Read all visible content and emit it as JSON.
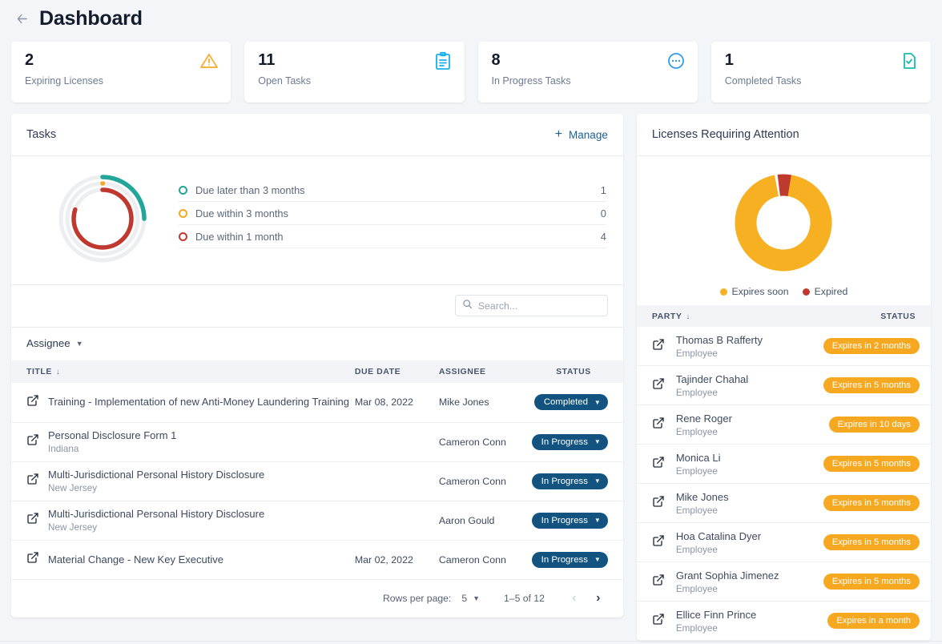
{
  "header": {
    "title": "Dashboard",
    "back_icon": "arrow-left-icon"
  },
  "stats": [
    {
      "value": "2",
      "label": "Expiring Licenses",
      "icon": "warning-triangle-icon",
      "color": "#f6b33d"
    },
    {
      "value": "11",
      "label": "Open Tasks",
      "icon": "clipboard-icon",
      "color": "#17b0f0"
    },
    {
      "value": "8",
      "label": "In Progress Tasks",
      "icon": "in-progress-circle-icon",
      "color": "#2f9ced"
    },
    {
      "value": "1",
      "label": "Completed Tasks",
      "icon": "document-check-icon",
      "color": "#17bcb0"
    }
  ],
  "tasks": {
    "title": "Tasks",
    "manage_label": "Manage",
    "plus_icon": "plus-icon",
    "search": {
      "placeholder": "Search...",
      "value": "",
      "icon": "search-icon"
    },
    "filter": {
      "label": "Assignee",
      "icon": "chevron-down-icon"
    },
    "columns": {
      "title": "TITLE",
      "due_date": "DUE DATE",
      "assignee": "ASSIGNEE",
      "status": "STATUS"
    },
    "rows": [
      {
        "icon": "open-external-icon",
        "title": "Training - Implementation of new Anti-Money Laundering Training",
        "subtitle": "",
        "due": "Mar 08, 2022",
        "assignee": "Mike Jones",
        "status": "Completed"
      },
      {
        "icon": "open-external-icon",
        "title": "Personal Disclosure Form 1",
        "subtitle": "Indiana",
        "due": "",
        "assignee": "Cameron Conn",
        "status": "In Progress"
      },
      {
        "icon": "open-external-icon",
        "title": "Multi-Jurisdictional Personal History Disclosure",
        "subtitle": "New Jersey",
        "due": "",
        "assignee": "Cameron Conn",
        "status": "In Progress"
      },
      {
        "icon": "open-external-icon",
        "title": "Multi-Jurisdictional Personal History Disclosure",
        "subtitle": "New Jersey",
        "due": "",
        "assignee": "Aaron Gould",
        "status": "In Progress"
      },
      {
        "icon": "open-external-icon",
        "title": "Material Change - New Key Executive",
        "subtitle": "",
        "due": "Mar 02, 2022",
        "assignee": "Cameron Conn",
        "status": "In Progress"
      }
    ],
    "pagination": {
      "rows_per_page_label": "Rows per page:",
      "rows_per_page_value": "5",
      "range": "1–5 of 12",
      "prev_icon": "chevron-left-icon",
      "next_icon": "chevron-right-icon"
    }
  },
  "licenses": {
    "title": "Licenses Requiring Attention",
    "columns": {
      "party": "PARTY",
      "status": "STATUS"
    },
    "rows": [
      {
        "icon": "open-external-icon",
        "name": "Thomas B Rafferty",
        "role": "Employee",
        "status": "Expires in 2 months"
      },
      {
        "icon": "open-external-icon",
        "name": "Tajinder Chahal",
        "role": "Employee",
        "status": "Expires in 5 months"
      },
      {
        "icon": "open-external-icon",
        "name": "Rene Roger",
        "role": "Employee",
        "status": "Expires in 10 days"
      },
      {
        "icon": "open-external-icon",
        "name": "Monica Li",
        "role": "Employee",
        "status": "Expires in 5 months"
      },
      {
        "icon": "open-external-icon",
        "name": "Mike Jones",
        "role": "Employee",
        "status": "Expires in 5 months"
      },
      {
        "icon": "open-external-icon",
        "name": "Hoa Catalina Dyer",
        "role": "Employee",
        "status": "Expires in 5 months"
      },
      {
        "icon": "open-external-icon",
        "name": "Grant Sophia Jimenez",
        "role": "Employee",
        "status": "Expires in 5 months"
      },
      {
        "icon": "open-external-icon",
        "name": "Ellice Finn Prince",
        "role": "Employee",
        "status": "Expires in a month"
      }
    ]
  },
  "chart_data": [
    {
      "type": "pie",
      "name": "tasks-due-donut",
      "title": "Tasks",
      "legend_position": "right",
      "categories": [
        "Due later than 3 months",
        "Due within 3 months",
        "Due within 1 month"
      ],
      "values": [
        1,
        0,
        4
      ],
      "colors": [
        "#22a699",
        "#f6a821",
        "#c0392f"
      ],
      "ring_style": "concentric-arcs",
      "rings": [
        {
          "label": "Due later than 3 months",
          "value": 1,
          "fraction": 0.25,
          "color": "#22a699",
          "radius_px": 52
        },
        {
          "label": "Due within 3 months",
          "value": 0,
          "fraction": 0.012,
          "color": "#f6a821",
          "radius_px": 44
        },
        {
          "label": "Due within 1 month",
          "value": 4,
          "fraction": 0.8,
          "color": "#c0392f",
          "radius_px": 36
        }
      ],
      "track_color": "#eceef0"
    },
    {
      "type": "pie",
      "name": "licenses-donut",
      "title": "Licenses Requiring Attention",
      "legend_position": "bottom",
      "categories": [
        "Expires soon",
        "Expired"
      ],
      "values": [
        19,
        1
      ],
      "percentages": [
        95,
        5
      ],
      "colors": [
        "#f6b021",
        "#c0392f"
      ],
      "inner_radius_ratio": 0.58
    }
  ]
}
